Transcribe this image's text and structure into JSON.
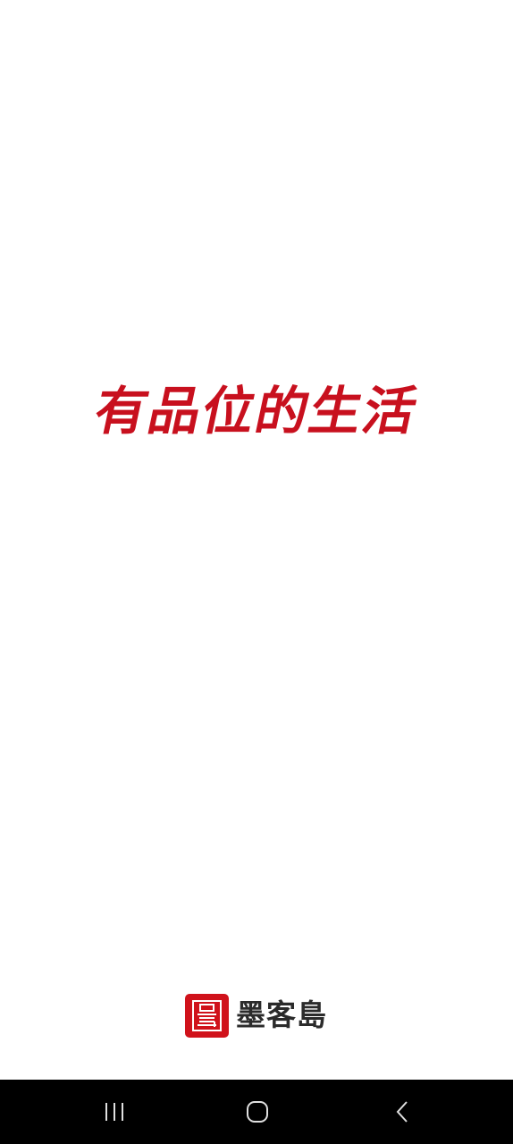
{
  "splash": {
    "slogan": "有品位的生活",
    "slogan_color": "#c8101e"
  },
  "brand": {
    "name": "墨客島",
    "logo_icon": "island-seal-logo-icon",
    "logo_color": "#d0121b"
  },
  "navbar": {
    "recents_icon": "recents-icon",
    "home_icon": "home-icon",
    "back_icon": "back-icon"
  }
}
